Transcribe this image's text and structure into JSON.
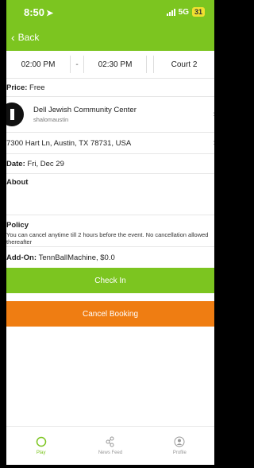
{
  "status_bar": {
    "time": "8:50",
    "network": "5G",
    "battery": "31"
  },
  "header": {
    "back_label": "Back"
  },
  "booking": {
    "start_time": "02:00 PM",
    "separator": "-",
    "end_time": "02:30 PM",
    "court": "Court 2",
    "price_label": "Price:",
    "price_value": "Free",
    "center_name": "Dell Jewish Community Center",
    "center_handle": "shalomaustin",
    "address": "7300 Hart Ln, Austin, TX 78731, USA",
    "date_label": "Date:",
    "date_value": "Fri, Dec 29",
    "about_label": "About",
    "policy_label": "Policy",
    "policy_text": "You can cancel anytime till 2 hours before the event. No cancellation allowed thereafter",
    "addon_label": "Add-On:",
    "addon_value": "TennBallMachine, $0.0"
  },
  "actions": {
    "check_in": "Check In",
    "cancel_booking": "Cancel Booking"
  },
  "tabbar": {
    "items": [
      {
        "label": "Play",
        "icon": "circle-icon",
        "active": true
      },
      {
        "label": "News Feed",
        "icon": "share-icon",
        "active": false
      },
      {
        "label": "Profile",
        "icon": "profile-icon",
        "active": false
      }
    ]
  },
  "colors": {
    "brand_green": "#7cc520",
    "cancel_orange": "#ef7d12"
  }
}
